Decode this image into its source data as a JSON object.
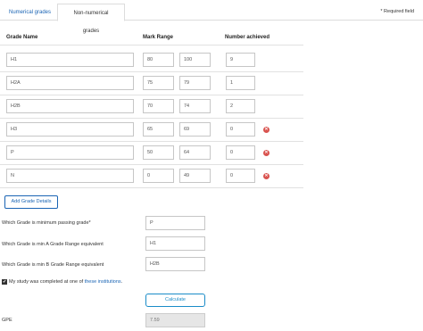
{
  "tabs": [
    {
      "label": "Numerical grades"
    },
    {
      "label": "Non-numerical grades"
    }
  ],
  "required_note": "* Required field",
  "table": {
    "headers": {
      "grade_name": "Grade Name",
      "mark_range": "Mark Range",
      "number_achieved": "Number achieved"
    },
    "rows": [
      {
        "grade": "H1",
        "min": "80",
        "max": "100",
        "count": "9",
        "removable": false
      },
      {
        "grade": "H2A",
        "min": "75",
        "max": "79",
        "count": "1",
        "removable": false
      },
      {
        "grade": "H2B",
        "min": "70",
        "max": "74",
        "count": "2",
        "removable": false
      },
      {
        "grade": "H3",
        "min": "65",
        "max": "69",
        "count": "0",
        "removable": true
      },
      {
        "grade": "P",
        "min": "50",
        "max": "64",
        "count": "0",
        "removable": true
      },
      {
        "grade": "N",
        "min": "0",
        "max": "49",
        "count": "0",
        "removable": true
      }
    ]
  },
  "add_grade_button": "Add Grade Details",
  "questions": {
    "min_passing": {
      "label": "Which Grade is minimum passing grade*",
      "value": "P"
    },
    "min_a": {
      "label": "Which Grade is min A Grade Range equivalent",
      "value": "H1"
    },
    "min_b": {
      "label": "Which Grade is min B Grade Range equivalent",
      "value": "H2B"
    }
  },
  "institution": {
    "checked": true,
    "text": "My study was completed at one of ",
    "link": "these institutions",
    "suffix": "."
  },
  "calculate_button": "Calculate",
  "gpe": {
    "label": "GPE",
    "value": "7.59"
  },
  "colors": {
    "accent": "#1a64b4",
    "remove": "#d9534f",
    "calc": "#1a8cc8"
  },
  "icons": {
    "checkbox": "check-icon",
    "remove": "remove-icon"
  }
}
